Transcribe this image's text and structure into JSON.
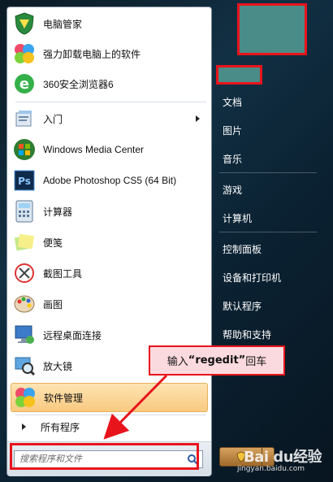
{
  "start_menu": {
    "pinned": [
      {
        "label": "电脑管家",
        "icon": "shield-icon"
      },
      {
        "label": "强力卸载电脑上的软件",
        "icon": "clover-icon"
      },
      {
        "label": "360安全浏览器6",
        "icon": "browser-e-icon"
      }
    ],
    "recent": [
      {
        "label": "入门",
        "icon": "getting-started-icon",
        "has_submenu": true
      },
      {
        "label": "Windows Media Center",
        "icon": "windows-logo-icon"
      },
      {
        "label": "Adobe Photoshop CS5 (64 Bit)",
        "icon": "photoshop-icon"
      },
      {
        "label": "计算器",
        "icon": "calculator-icon"
      },
      {
        "label": "便笺",
        "icon": "sticky-notes-icon"
      },
      {
        "label": "截图工具",
        "icon": "scissors-icon"
      },
      {
        "label": "画图",
        "icon": "paint-palette-icon"
      },
      {
        "label": "远程桌面连接",
        "icon": "remote-desktop-icon"
      },
      {
        "label": "放大镜",
        "icon": "magnifier-icon"
      },
      {
        "label": "软件管理",
        "icon": "clover-icon",
        "highlighted": true
      }
    ],
    "all_programs_label": "所有程序",
    "search": {
      "placeholder": "搜索程序和文件",
      "value": ""
    },
    "right_items": [
      "文档",
      "图片",
      "音乐",
      "游戏",
      "计算机",
      "控制面板",
      "设备和打印机",
      "默认程序",
      "帮助和支持"
    ]
  },
  "annotation": {
    "prefix": "输入",
    "command": "“regedit”",
    "suffix": "回车"
  },
  "watermark": {
    "brand": "Bai du经验",
    "url": "jingyan.baidu.com"
  },
  "colors": {
    "highlight_border": "#e8141c",
    "callout_bg": "#fbdadf",
    "avatar_placeholder": "#4a8c87"
  }
}
